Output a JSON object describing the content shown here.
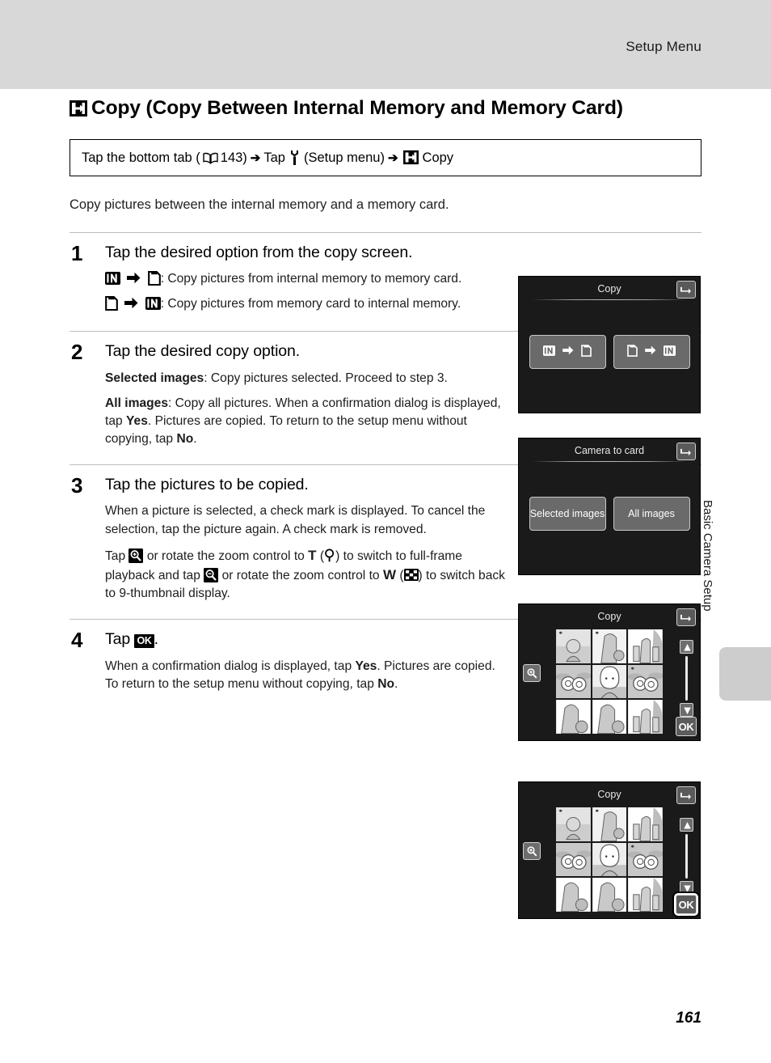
{
  "header": {
    "title": "Setup Menu"
  },
  "side_tab": {
    "label": "Basic Camera Setup"
  },
  "page": {
    "number": "161"
  },
  "chapter": {
    "icon": "copy-icon",
    "title": "Copy (Copy Between Internal Memory and Memory Card)"
  },
  "breadcrumb": {
    "part1": "Tap the bottom tab (",
    "book_icon": "book-icon",
    "page_ref": "143",
    "part2": ")",
    "arrow1": "➔",
    "part3": "Tap",
    "wrench_icon": "wrench-icon",
    "part4": "(Setup menu)",
    "arrow2": "➔",
    "copy_icon": "copy-icon",
    "part5": "Copy"
  },
  "intro": "Copy pictures between the internal memory and a memory card.",
  "steps": [
    {
      "number": "1",
      "heading": "Tap the desired option from the copy screen.",
      "paras": [
        {
          "lead_icons": [
            "internal-memory-icon",
            "arrow-right-icon",
            "memory-card-icon"
          ],
          "text": ": Copy pictures from internal memory to memory card."
        },
        {
          "lead_icons": [
            "memory-card-icon",
            "arrow-right-icon",
            "internal-memory-icon"
          ],
          "text": ": Copy pictures from memory card to internal memory."
        }
      ]
    },
    {
      "number": "2",
      "heading": "Tap the desired copy option.",
      "paras": [
        {
          "bold": "Selected images",
          "text": ": Copy pictures selected. Proceed to step 3."
        },
        {
          "bold": "All images",
          "text": ": Copy all pictures. When a confirmation dialog is displayed, tap Yes. Pictures are copied. To return to the setup menu without copying, tap No.",
          "bold_inline": [
            "Yes",
            "No"
          ]
        }
      ]
    },
    {
      "number": "3",
      "heading": "Tap the pictures to be copied.",
      "paras": [
        {
          "text": "When a picture is selected, a check mark is displayed. To cancel the selection, tap the picture again. A check mark is removed."
        },
        {
          "text": "Tap [zoom-in-icon] or rotate the zoom control to T (magnifier-icon) to switch to full-frame playback and tap [zoom-out-icon] or rotate the zoom control to W (thumbnail-9-icon) to switch back to 9-thumbnail display.",
          "tele_label": "T",
          "wide_label": "W"
        }
      ]
    },
    {
      "number": "4",
      "heading": "Tap OK.",
      "heading_prefix": "Tap",
      "heading_icon": "ok-icon",
      "heading_suffix": ".",
      "paras": [
        {
          "text": "When a confirmation dialog is displayed, tap Yes. Pictures are copied. To return to the setup menu without copying, tap No.",
          "bold_inline": [
            "Yes",
            "No"
          ]
        }
      ]
    }
  ],
  "screens": [
    {
      "id": "screen-copy-source",
      "title": "Copy",
      "back_icon": "back-arrow-icon",
      "options": [
        {
          "id": "internal-to-card",
          "icons": [
            "internal-memory-icon",
            "arrow-right-icon",
            "memory-card-icon"
          ]
        },
        {
          "id": "card-to-internal",
          "icons": [
            "memory-card-icon",
            "arrow-right-icon",
            "internal-memory-icon"
          ]
        }
      ]
    },
    {
      "id": "screen-camera-to-card",
      "title": "Camera to card",
      "back_icon": "back-arrow-icon",
      "options": [
        {
          "id": "selected-images",
          "label": "Selected images"
        },
        {
          "id": "all-images",
          "label": "All images"
        }
      ]
    },
    {
      "id": "screen-select-pictures",
      "title": "Copy",
      "back_icon": "back-arrow-icon",
      "zoom_icon": "zoom-in-icon",
      "up_icon": "arrow-up-icon",
      "down_icon": "arrow-down-icon",
      "ok_label": "OK",
      "ok_highlighted": false
    },
    {
      "id": "screen-confirm-copy",
      "title": "Copy",
      "back_icon": "back-arrow-icon",
      "zoom_icon": "zoom-in-icon",
      "up_icon": "arrow-up-icon",
      "down_icon": "arrow-down-icon",
      "ok_label": "OK",
      "ok_highlighted": true
    }
  ],
  "thumbnails": [
    {
      "type": "portrait-hat-landscape",
      "checked": true
    },
    {
      "type": "woman-child",
      "checked": true
    },
    {
      "type": "family-tree",
      "checked": false
    },
    {
      "type": "flowers",
      "checked": false
    },
    {
      "type": "portrait-closeup",
      "checked": false
    },
    {
      "type": "flowers",
      "checked": true
    },
    {
      "type": "woman-child",
      "checked": false
    },
    {
      "type": "woman-child",
      "checked": false
    },
    {
      "type": "family-tree",
      "checked": false
    }
  ],
  "colors": {
    "header_bar": "#d8d8d8",
    "side_tab": "#cdcdcd",
    "screen_bg": "#1a1a1a",
    "button_bg": "#6a6a6a",
    "thumb_bg": "#cfcfcf",
    "divider": "#bdbdbd"
  }
}
